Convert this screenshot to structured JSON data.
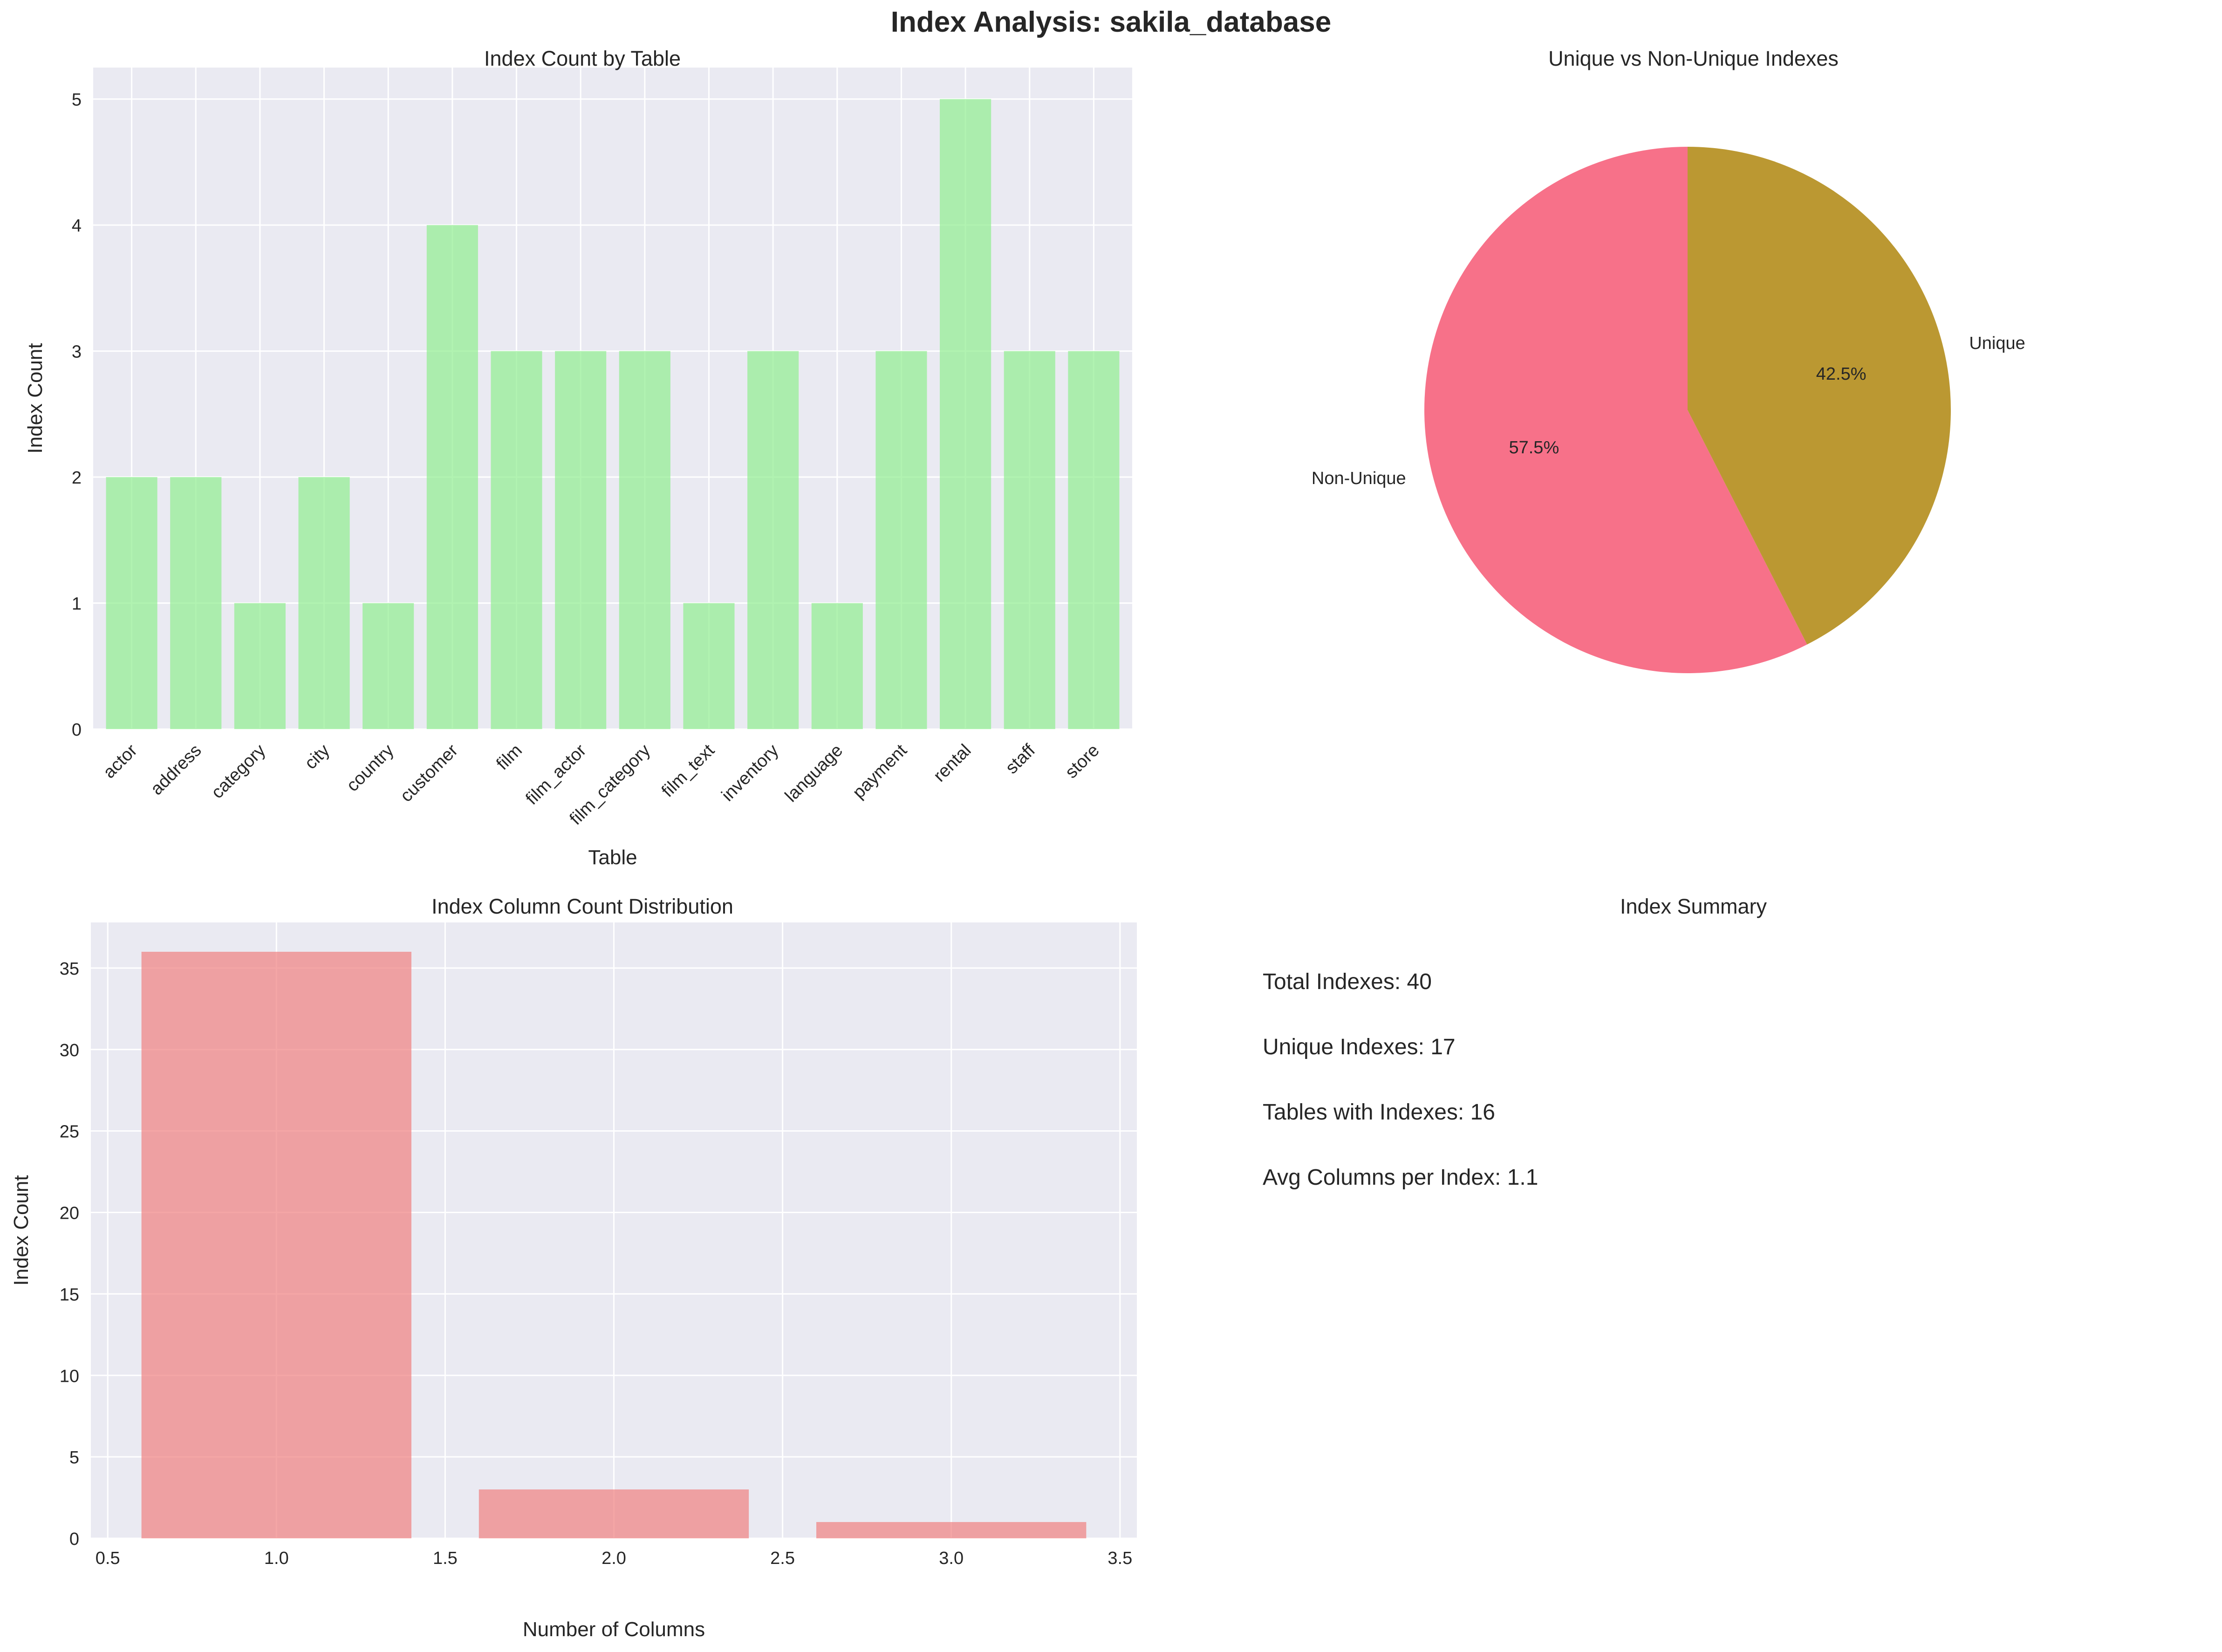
{
  "title": "Index Analysis: sakila_database",
  "colors": {
    "plot_background": "#EAEAF2",
    "grid": "#FFFFFF",
    "bar_green": "#90EE90",
    "bar_red": "#F08080",
    "pie_non_unique": "#F77189",
    "pie_unique": "#BB9832"
  },
  "chart_data": [
    {
      "type": "bar",
      "title": "Index Count by Table",
      "xlabel": "Table",
      "ylabel": "Index Count",
      "categories": [
        "actor",
        "address",
        "category",
        "city",
        "country",
        "customer",
        "film",
        "film_actor",
        "film_category",
        "film_text",
        "inventory",
        "language",
        "payment",
        "rental",
        "staff",
        "store"
      ],
      "values": [
        2,
        2,
        1,
        2,
        1,
        4,
        3,
        3,
        3,
        1,
        3,
        1,
        3,
        5,
        3,
        3
      ],
      "ylim": [
        0,
        5.25
      ],
      "yticks": [
        0,
        1,
        2,
        3,
        4,
        5
      ],
      "grid": true,
      "legend": "none"
    },
    {
      "type": "pie",
      "title": "Unique vs Non-Unique Indexes",
      "labels": [
        "Non-Unique",
        "Unique"
      ],
      "values": [
        23,
        17
      ],
      "percent_labels": [
        "57.5%",
        "42.5%"
      ],
      "start_angle_deg": 90
    },
    {
      "type": "bar",
      "title": "Index Column Count Distribution",
      "xlabel": "Number of Columns",
      "ylabel": "Index Count",
      "x": [
        1,
        2,
        3
      ],
      "values": [
        36,
        3,
        1
      ],
      "bar_width": 0.8,
      "xlim": [
        0.45,
        3.55
      ],
      "ylim": [
        0,
        37.8
      ],
      "xticks": [
        "0.5",
        "1.0",
        "1.5",
        "2.0",
        "2.5",
        "3.0",
        "3.5"
      ],
      "yticks": [
        0,
        5,
        10,
        15,
        20,
        25,
        30,
        35
      ],
      "grid": true
    }
  ],
  "summary": {
    "title": "Index Summary",
    "lines": [
      "Total Indexes: 40",
      "Unique Indexes: 17",
      "Tables with Indexes: 16",
      "Avg Columns per Index: 1.1"
    ]
  }
}
